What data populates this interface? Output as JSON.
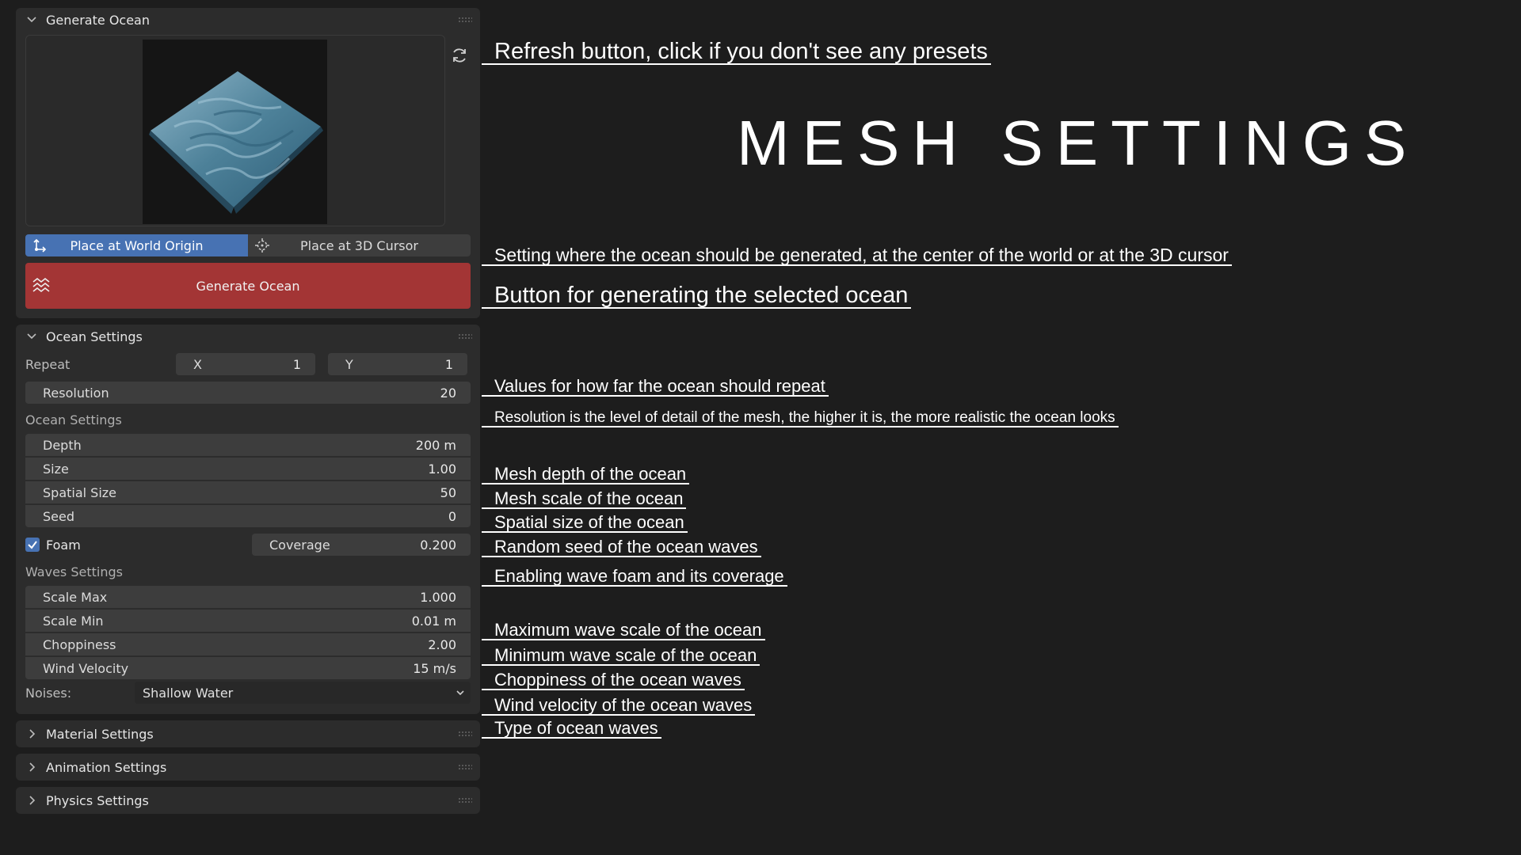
{
  "generate_panel": {
    "title": "Generate Ocean",
    "place_world_label": "Place at World Origin",
    "place_cursor_label": "Place at 3D Cursor",
    "generate_label": "Generate Ocean",
    "icons": {
      "refresh": "refresh-icon",
      "world_origin": "world-origin-icon",
      "cursor": "3d-cursor-icon",
      "ocean": "ocean-waves-icon"
    },
    "colors": {
      "active": "#4772b3",
      "generate": "#a33535"
    }
  },
  "ocean_panel": {
    "title": "Ocean Settings",
    "repeat": {
      "label": "Repeat",
      "x_label": "X",
      "x_value": "1",
      "y_label": "Y",
      "y_value": "1"
    },
    "resolution": {
      "label": "Resolution",
      "value": "20"
    },
    "ocean_section_label": "Ocean Settings",
    "ocean_fields": [
      {
        "label": "Depth",
        "value": "200 m"
      },
      {
        "label": "Size",
        "value": "1.00"
      },
      {
        "label": "Spatial Size",
        "value": "50"
      },
      {
        "label": "Seed",
        "value": "0"
      }
    ],
    "foam": {
      "label": "Foam",
      "checked": true,
      "coverage_label": "Coverage",
      "coverage_value": "0.200"
    },
    "waves_section_label": "Waves Settings",
    "wave_fields": [
      {
        "label": "Scale Max",
        "value": "1.000"
      },
      {
        "label": "Scale Min",
        "value": "0.01 m"
      },
      {
        "label": "Choppiness",
        "value": "2.00"
      },
      {
        "label": "Wind Velocity",
        "value": "15 m/s"
      }
    ],
    "noises": {
      "label": "Noises:",
      "value": "Shallow Water"
    }
  },
  "collapsed_panels": [
    "Material Settings",
    "Animation Settings",
    "Physics Settings"
  ],
  "page_title": "MESH SETTINGS",
  "annotations": {
    "refresh": "Refresh button, click if you don't see any presets",
    "place": "Setting where the ocean should be generated, at the center of the world or at the 3D cursor",
    "generate": "Button for generating the selected ocean",
    "repeat": "Values for how far the ocean should repeat",
    "resolution": "Resolution is the level of detail of the mesh, the higher it is, the more realistic the ocean looks",
    "depth": "Mesh depth of the ocean",
    "size": "Mesh scale of the ocean",
    "spatial": "Spatial size of the ocean",
    "seed": "Random seed of the ocean waves",
    "foam": "Enabling wave foam and its coverage",
    "scale_max": "Maximum wave scale of the ocean",
    "scale_min": "Minimum wave scale of the ocean",
    "choppiness": "Choppiness of the ocean waves",
    "wind": "Wind velocity of the ocean waves",
    "noises": "Type of ocean waves"
  }
}
